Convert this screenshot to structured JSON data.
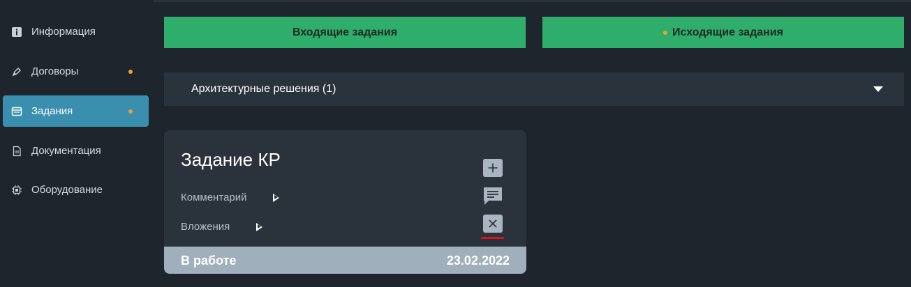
{
  "sidebar": {
    "items": [
      {
        "label": "Информация",
        "icon": "info-icon",
        "active": false,
        "dot": false
      },
      {
        "label": "Договоры",
        "icon": "pen-icon",
        "active": false,
        "dot": true
      },
      {
        "label": "Задания",
        "icon": "window-icon",
        "active": true,
        "dot": true
      },
      {
        "label": "Документация",
        "icon": "document-icon",
        "active": false,
        "dot": false
      },
      {
        "label": "Оборудование",
        "icon": "chip-icon",
        "active": false,
        "dot": false
      }
    ]
  },
  "tabs": {
    "incoming": "Входящие задания",
    "outgoing": "Исходящие задания"
  },
  "accordion": {
    "label": "Архитектурные решения (1)"
  },
  "card": {
    "title": "Задание КР",
    "comment_label": "Комментарий",
    "attachments_label": "Вложения",
    "status": "В работе",
    "date": "23.02.2022"
  },
  "colors": {
    "background": "#1e252c",
    "panel": "#2a323b",
    "accent_active": "#3a8fae",
    "tab_green": "#2fad6a",
    "notification_dot": "#f0a030",
    "footer": "#a0afbc",
    "highlight_red": "#e0101a"
  }
}
